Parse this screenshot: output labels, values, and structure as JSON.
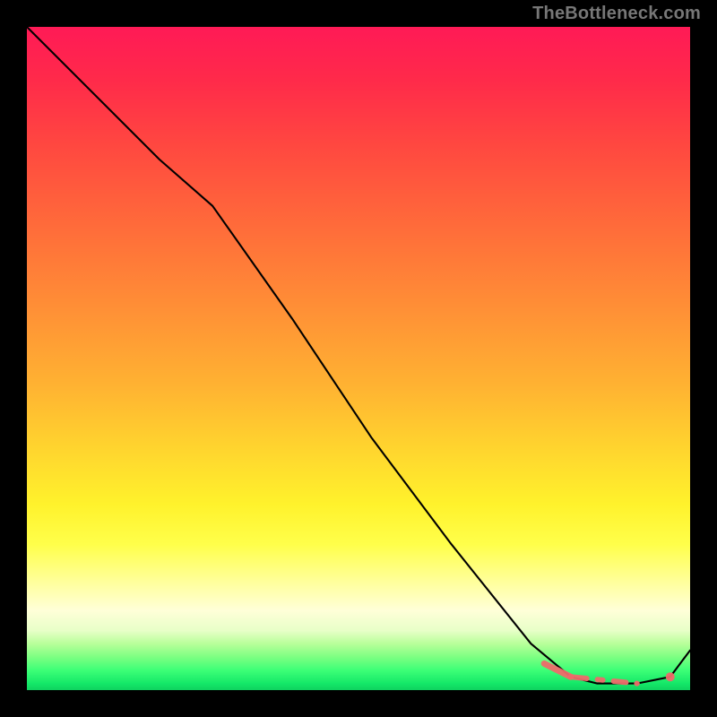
{
  "watermark": "TheBottleneck.com",
  "colors": {
    "background": "#000000",
    "line": "#000000",
    "marker": "#ef6a6a"
  },
  "chart_data": {
    "type": "line",
    "title": "",
    "xlabel": "",
    "ylabel": "",
    "xlim": [
      0,
      100
    ],
    "ylim": [
      0,
      100
    ],
    "grid": false,
    "legend": false,
    "series": [
      {
        "name": "main-curve",
        "x": [
          0,
          10,
          20,
          28,
          40,
          52,
          64,
          76,
          82,
          86,
          92,
          97,
          100
        ],
        "y": [
          100,
          90,
          80,
          73,
          56,
          38,
          22,
          7,
          2,
          1,
          1,
          2,
          6
        ]
      }
    ],
    "markers": {
      "solid_segment": {
        "x": [
          78,
          82
        ],
        "y": [
          4,
          2
        ]
      },
      "dashed_segment": {
        "x": [
          82,
          92
        ],
        "y": [
          2,
          1
        ]
      },
      "point": {
        "x": 97,
        "y": 2
      }
    },
    "gradient_stops": [
      {
        "pos": 0,
        "color": "#ff1a56"
      },
      {
        "pos": 18,
        "color": "#ff4840"
      },
      {
        "pos": 42,
        "color": "#ff8e36"
      },
      {
        "pos": 64,
        "color": "#ffd62e"
      },
      {
        "pos": 84,
        "color": "#ffffa0"
      },
      {
        "pos": 95,
        "color": "#7dff82"
      },
      {
        "pos": 100,
        "color": "#0fd15f"
      }
    ]
  }
}
